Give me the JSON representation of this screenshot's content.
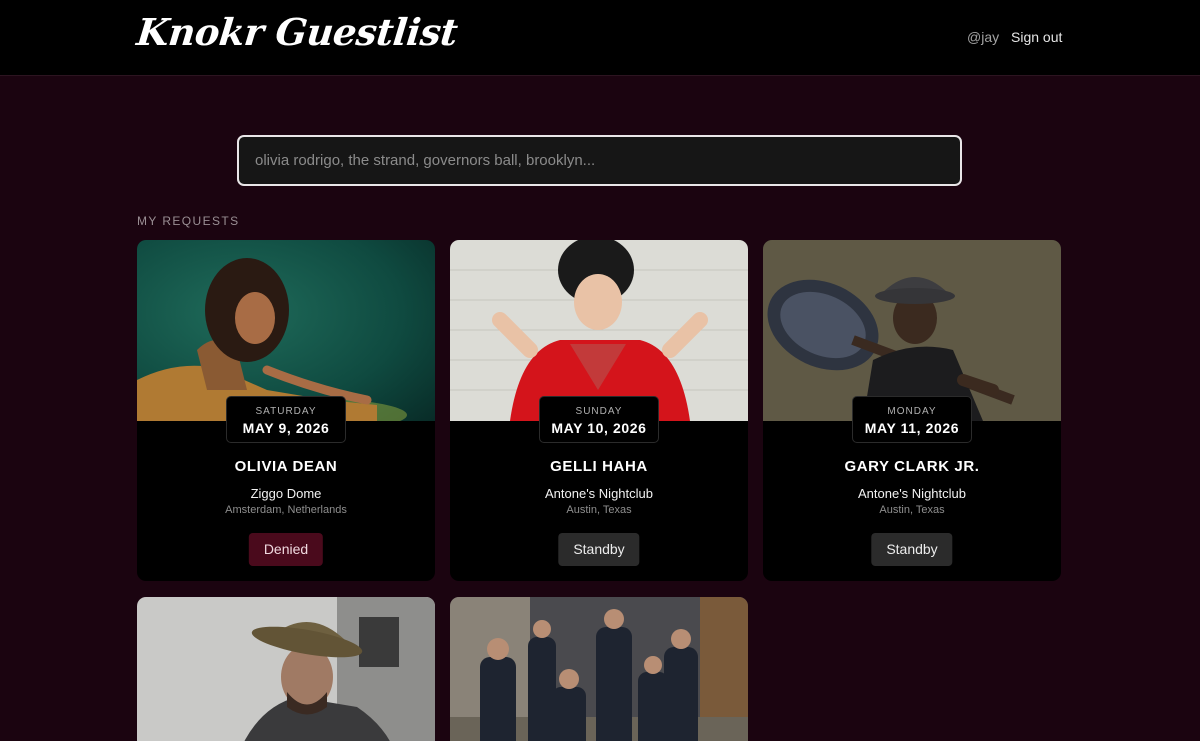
{
  "header": {
    "logo": "Knokr Guestlist",
    "user_handle": "@jay",
    "sign_out": "Sign out"
  },
  "search": {
    "placeholder": "olivia rodrigo, the strand, governors ball, brooklyn..."
  },
  "section_label": "MY REQUESTS",
  "requests": [
    {
      "day": "SATURDAY",
      "date": "MAY 9, 2026",
      "artist": "OLIVIA DEAN",
      "venue": "Ziggo Dome",
      "location": "Amsterdam, Netherlands",
      "status": "Denied"
    },
    {
      "day": "SUNDAY",
      "date": "MAY 10, 2026",
      "artist": "GELLI HAHA",
      "venue": "Antone's Nightclub",
      "location": "Austin, Texas",
      "status": "Standby"
    },
    {
      "day": "MONDAY",
      "date": "MAY 11, 2026",
      "artist": "GARY CLARK JR.",
      "venue": "Antone's Nightclub",
      "location": "Austin, Texas",
      "status": "Standby"
    }
  ],
  "colors": {
    "page_bg": "#1b0410",
    "header_bg": "#000000",
    "card_bg": "#000000",
    "denied_bg": "#4a0a1c",
    "standby_bg": "#2b2b2b"
  }
}
